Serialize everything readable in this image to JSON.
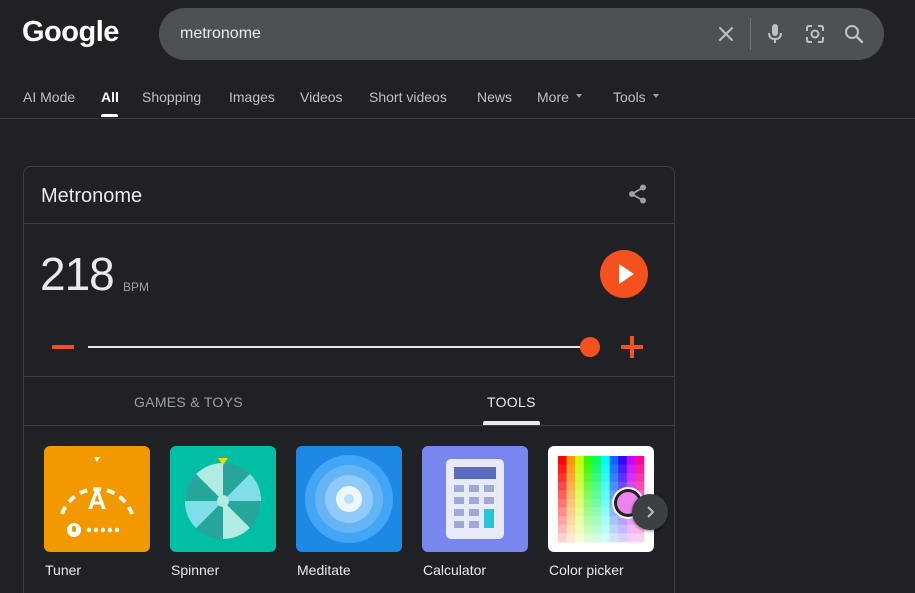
{
  "logo": "Google",
  "search": {
    "query": "metronome",
    "clear_icon": "close-icon",
    "voice_icon": "microphone-icon",
    "lens_icon": "camera-lens-icon",
    "search_icon": "search-icon"
  },
  "tabs": [
    {
      "label": "AI Mode"
    },
    {
      "label": "All"
    },
    {
      "label": "Shopping"
    },
    {
      "label": "Images"
    },
    {
      "label": "Videos"
    },
    {
      "label": "Short videos"
    },
    {
      "label": "News"
    },
    {
      "label": "More"
    },
    {
      "label": "Tools"
    }
  ],
  "active_tab": "All",
  "metronome": {
    "title": "Metronome",
    "bpm": "218",
    "bpm_unit": "BPM",
    "slider_fraction": 0.98,
    "accent_color": "#f4511e"
  },
  "subtabs": [
    {
      "label": "GAMES & TOYS"
    },
    {
      "label": "TOOLS"
    }
  ],
  "active_subtab": "TOOLS",
  "tools": [
    {
      "label": "Tuner",
      "color": "#f29900",
      "tuner_letter": "A"
    },
    {
      "label": "Spinner",
      "color": "#00bfa5"
    },
    {
      "label": "Meditate",
      "color": "#1e88e5"
    },
    {
      "label": "Calculator",
      "color": "#7986f0"
    },
    {
      "label": "Color picker",
      "color": "#ffffff"
    }
  ]
}
